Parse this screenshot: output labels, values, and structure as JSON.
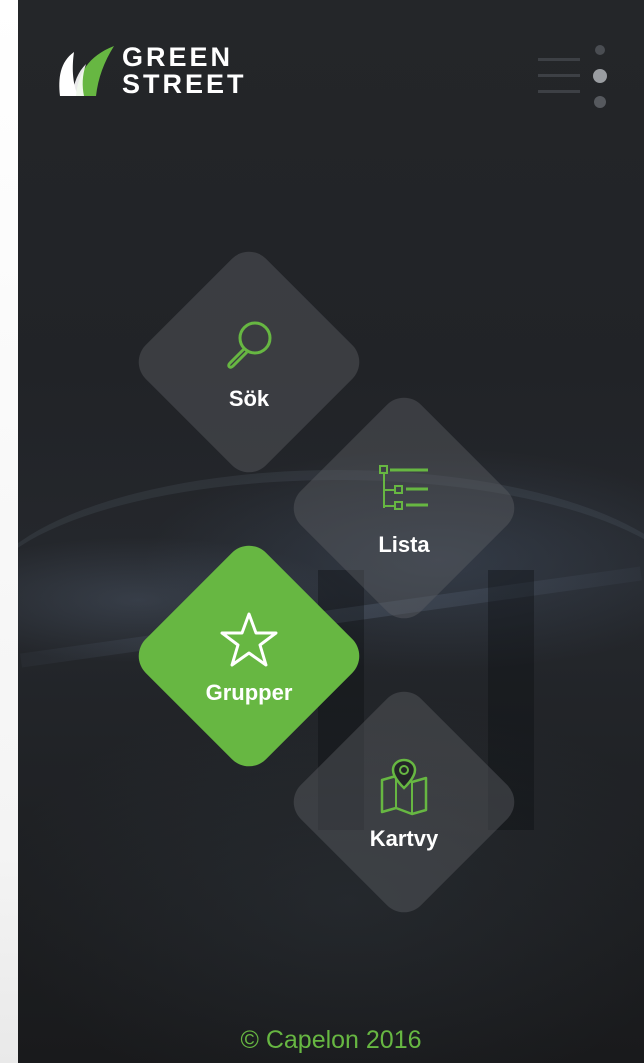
{
  "header": {
    "logo_line1": "GREEN",
    "logo_line2": "STREET",
    "menu_icon": "list-menu-icon"
  },
  "menu": {
    "items": [
      {
        "label": "Sök",
        "icon": "search-icon",
        "active": false
      },
      {
        "label": "Lista",
        "icon": "list-tree-icon",
        "active": false
      },
      {
        "label": "Grupper",
        "icon": "star-icon",
        "active": true
      },
      {
        "label": "Kartvy",
        "icon": "map-pin-icon",
        "active": false
      }
    ]
  },
  "footer": {
    "copyright": "© Capelon 2016"
  },
  "colors": {
    "accent": "#67b742",
    "background": "#232528",
    "tile": "#505357"
  }
}
